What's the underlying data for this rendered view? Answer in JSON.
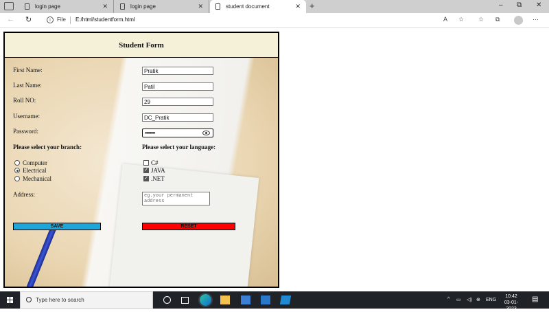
{
  "browser": {
    "tabs": [
      {
        "label": "login page",
        "active": false
      },
      {
        "label": "login page",
        "active": false
      },
      {
        "label": "student document",
        "active": true
      }
    ],
    "new_tab": "+",
    "window": {
      "minimize": "–",
      "restore": "⧉",
      "close": "✕"
    },
    "address": {
      "scheme": "File",
      "url": "E:/html/studentform.html"
    }
  },
  "form": {
    "title": "Student Form",
    "fields": {
      "first_name": {
        "label": "First Name:",
        "value": "Pratik"
      },
      "last_name": {
        "label": "Last Name:",
        "value": "Patil"
      },
      "roll_no": {
        "label": "Roll NO:",
        "value": "29"
      },
      "username": {
        "label": "Username:",
        "value": "DC_Pratik"
      },
      "password": {
        "label": "Password:",
        "masked": "••••••••"
      }
    },
    "branch": {
      "label": "Please select your branch:",
      "options": [
        "Computer",
        "Electrical",
        "Mechanical"
      ],
      "selected": "Electrical"
    },
    "language": {
      "label": "Please select your language:",
      "options": [
        {
          "label": "C#",
          "checked": false
        },
        {
          "label": "JAVA",
          "checked": true
        },
        {
          "label": ".NET",
          "checked": true
        }
      ]
    },
    "address": {
      "label": "Address:",
      "placeholder": "eg.your permanent address"
    },
    "buttons": {
      "save": "SAVE",
      "reset": "RESET"
    }
  },
  "taskbar": {
    "search_placeholder": "Type here to search",
    "language": "ENG",
    "time": "10:42",
    "date": "03-01-2023"
  },
  "colors": {
    "save": "#1ea6d9",
    "reset": "#ff0000",
    "header": "#f4f1d8"
  }
}
